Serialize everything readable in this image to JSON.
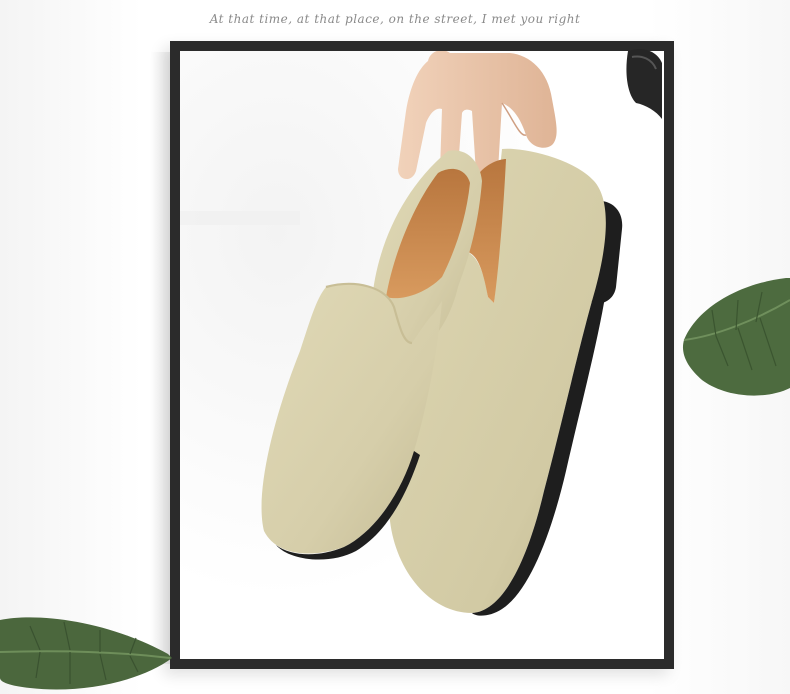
{
  "caption": "At that time, at that place, on the street, I met you right",
  "scene": {
    "icons": [
      "picture-frame",
      "suede-loafers",
      "hand",
      "leaf",
      "leaf"
    ],
    "colors": {
      "frame": "#2b2b2b",
      "suede": "#d9d2ad",
      "suede_shade": "#bfb68e",
      "lining": "#c98a4e",
      "sole": "#1e1e1e",
      "skin": "#e8c4a8",
      "leaf": "#4d6b3f",
      "caption": "#8a8a8a"
    }
  }
}
